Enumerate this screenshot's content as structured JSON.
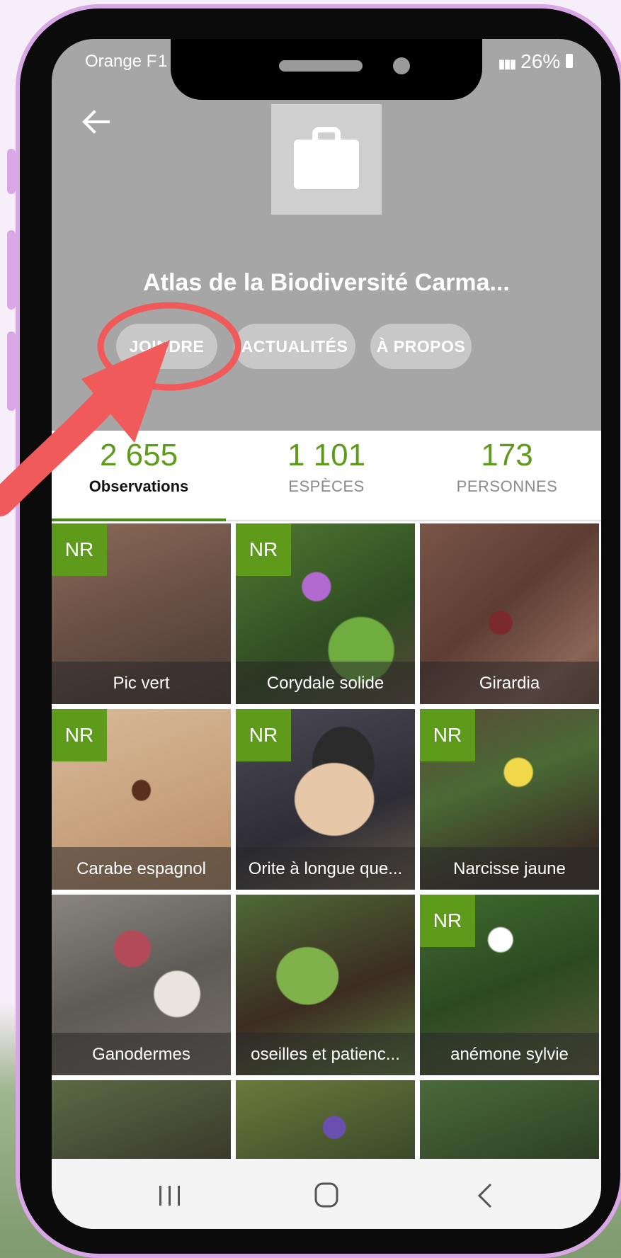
{
  "status_bar": {
    "carrier": "Orange F",
    "time": "1",
    "battery": "26%"
  },
  "header": {
    "back_icon": "back-arrow-icon",
    "logo_icon": "briefcase-icon",
    "title": "Atlas de la Biodiversité Carma...",
    "buttons": [
      "JOINDRE",
      "ACTUALITÉS",
      "À PROPOS"
    ]
  },
  "stats": [
    {
      "value": "2 655",
      "label": "Observations",
      "active": true
    },
    {
      "value": "1 101",
      "label": "ESPÈCES",
      "active": false
    },
    {
      "value": "173",
      "label": "PERSONNES",
      "active": false
    }
  ],
  "observations": [
    {
      "name": "Pic vert",
      "badge": "NR"
    },
    {
      "name": "Corydale solide",
      "badge": "NR"
    },
    {
      "name": "Girardia",
      "badge": ""
    },
    {
      "name": "Carabe espagnol",
      "badge": "NR"
    },
    {
      "name": "Orite à longue que...",
      "badge": "NR"
    },
    {
      "name": "Narcisse jaune",
      "badge": "NR"
    },
    {
      "name": "Ganodermes",
      "badge": ""
    },
    {
      "name": "oseilles et patienc...",
      "badge": ""
    },
    {
      "name": "anémone sylvie",
      "badge": "NR"
    }
  ],
  "nav_bar": {
    "recents_icon": "recents-icon",
    "home_icon": "home-icon",
    "back_icon": "back-chevron-icon"
  },
  "colors": {
    "accent_green": "#5e9b1a",
    "header_gray": "#a6a6a6",
    "highlight_red": "#f05a5a",
    "phone_frame": "#d9a6e6"
  }
}
